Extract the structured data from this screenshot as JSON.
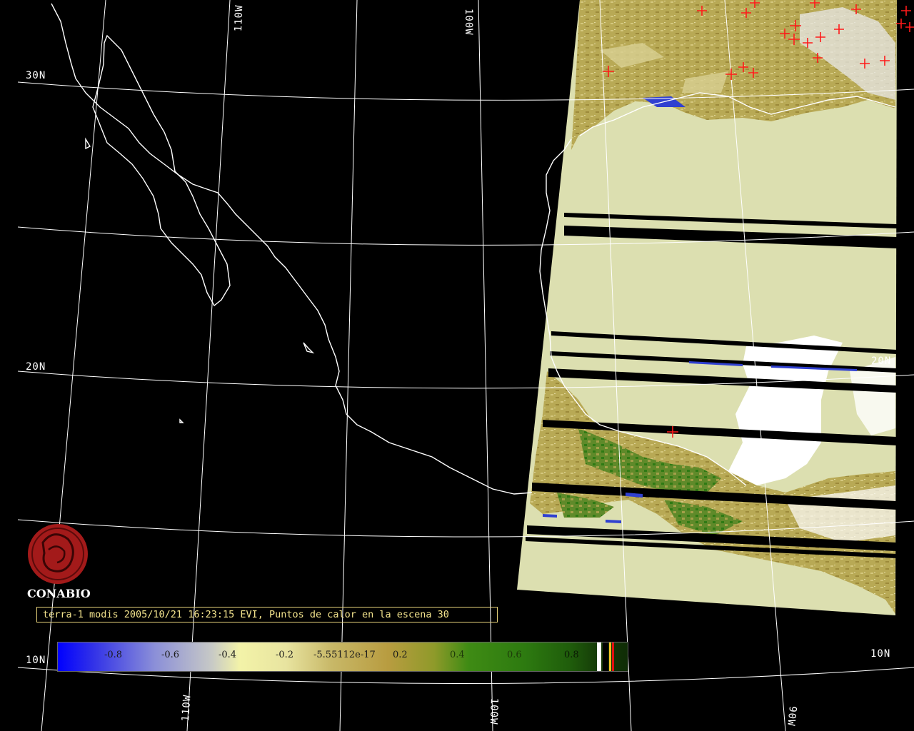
{
  "grid_labels": {
    "lat": [
      "30N",
      "20N",
      "10N",
      "20N",
      "10N"
    ],
    "lon": [
      "110W",
      "100W",
      "110W",
      "100W",
      "90W"
    ]
  },
  "logo_text": "CONABIO",
  "caption": "terra-1 modis 2005/10/21 16:23:15 EVI, Puntos de calor en la escena 30",
  "colorbar": {
    "labels": [
      "-0.8",
      "-0.6",
      "-0.4",
      "-0.2",
      "-5.55112e-17",
      "0.2",
      "0.4",
      "0.6",
      "0.8"
    ]
  },
  "colors": {
    "background": "#000000",
    "grid": "#ffffff",
    "coast": "#ffffff",
    "sea_in_scene": "#dcdfb0",
    "land_in_scene": "#b9aa55",
    "cloud": "#ffffff",
    "hotspot": "#ff1a1a",
    "caption_text": "#f3e38d",
    "logo": "#a31a1a"
  }
}
